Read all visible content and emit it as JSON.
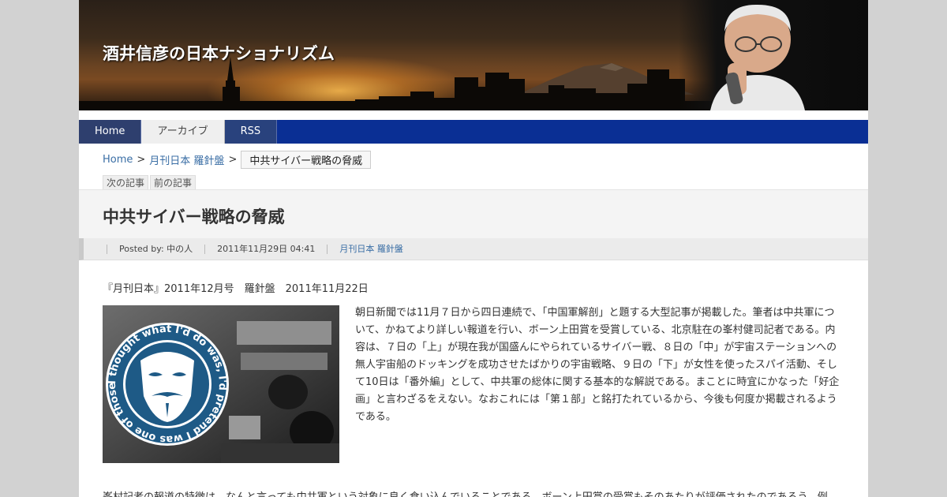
{
  "header": {
    "site_title": "酒井信彦の日本ナショナリズム"
  },
  "nav": {
    "items": [
      {
        "label": "Home"
      },
      {
        "label": "アーカイブ"
      },
      {
        "label": "RSS"
      }
    ]
  },
  "breadcrumb": {
    "home": "Home",
    "separator": ">",
    "category": "月刊日本 羅針盤",
    "current": "中共サイバー戦略の脅威"
  },
  "post_nav": {
    "next": "次の記事",
    "prev": "前の記事"
  },
  "post": {
    "title": "中共サイバー戦略の脅威",
    "posted_by": "Posted by: 中の人",
    "date": "2011年11月29日 04:41",
    "category": "月刊日本 羅針盤",
    "source": "『月刊日本』2011年12月号　羅針盤　2011年11月22日",
    "paragraph1": "朝日新聞では11月７日から四日連続で、「中国軍解剖」と題する大型記事が掲載した。筆者は中共軍について、かねてより詳しい報道を行い、ボーン上田賞を受賞している、北京駐在の峯村健司記者である。内容は、７日の「上」が現在我が国盛んにやられているサイバー戦、８日の「中」が宇宙ステーションへの無人宇宙船のドッキングを成功させたばかりの宇宙戦略、９日の「下」が女性を使ったスパイ活動、そして10日は「番外編」として、中共軍の総体に関する基本的な解説である。まことに時宜にかなった「好企画」と言わざるをえない。なおこれには「第１部」と銘打たれているから、今後も何度か掲載されるようである。",
    "paragraph2": "峯村記者の報道の特徴は、なんと言っても中共軍という対象に良く食い込んでいることである。ボーン上田賞の受賞もそのあたりが評価されたのであろう。例",
    "image_text": "I thought what I'd do was, I'd pretend I was one of those deaf-mutes"
  },
  "colors": {
    "nav_bg": "#0a2f94",
    "link": "#3a6ea5",
    "page_bg": "#d2d2d2"
  }
}
